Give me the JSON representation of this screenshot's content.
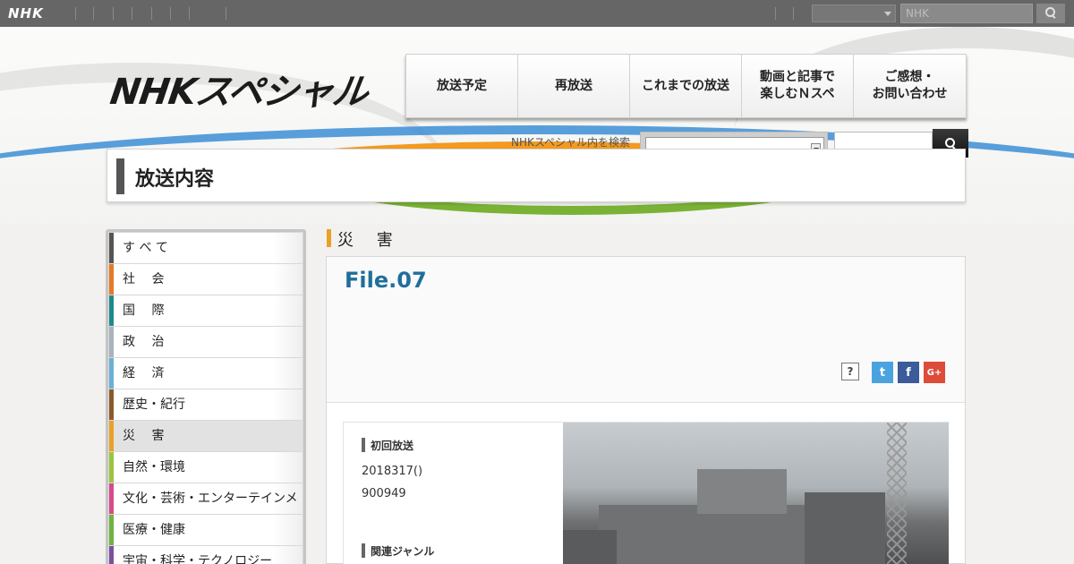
{
  "global": {
    "logo": "NHK",
    "search_placeholder": "NHK"
  },
  "header": {
    "brand": "NHKスペシャル",
    "nav": [
      {
        "line1": "放送予定",
        "line2": ""
      },
      {
        "line1": "再放送",
        "line2": ""
      },
      {
        "line1": "これまでの放送",
        "line2": ""
      },
      {
        "line1": "動画と記事で",
        "line2": "楽しむＮスペ"
      },
      {
        "line1": "ご感想・",
        "line2": "お問い合わせ"
      }
    ],
    "site_search_label": "NHKスペシャル内を検索"
  },
  "page_title": "放送内容",
  "sidebar": {
    "items": [
      {
        "label": "す べ て",
        "color": "#555555"
      },
      {
        "label": "社　 会",
        "color": "#e57a25"
      },
      {
        "label": "国　 際",
        "color": "#1f8a8a"
      },
      {
        "label": "政　 治",
        "color": "#a9b2bd"
      },
      {
        "label": "経　 済",
        "color": "#6ab0d8"
      },
      {
        "label": "歴史・紀行",
        "color": "#8b5a2b"
      },
      {
        "label": "災　 害",
        "color": "#eaa128"
      },
      {
        "label": "自然・環境",
        "color": "#9cc53c"
      },
      {
        "label": "文化・芸術・エンターテインメント",
        "color": "#d64a8c"
      },
      {
        "label": "医療・健康",
        "color": "#6fb33f"
      },
      {
        "label": "宇宙・科学・テクノロジー",
        "color": "#7b4fa0"
      }
    ],
    "active_index": 6
  },
  "content": {
    "genre": "災 害",
    "title": "File.07",
    "social": {
      "help": "?",
      "twitter": "t",
      "facebook": "f",
      "google": "G+"
    },
    "broadcast_label": "初回放送",
    "broadcast_date": "2018317()",
    "broadcast_time": "900949",
    "genre_label": "関連ジャンル"
  }
}
